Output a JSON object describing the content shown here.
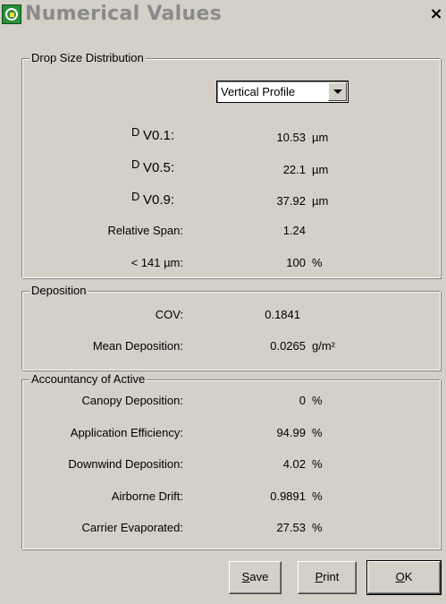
{
  "window": {
    "title": "Numerical Values",
    "close_glyph": "×"
  },
  "drop_size": {
    "legend": "Drop Size Distribution",
    "profile_select": {
      "selected": "Vertical Profile"
    },
    "dv01": {
      "main": "D",
      "sub": "V0.1",
      "suffix": ":",
      "value": "10.53",
      "unit": "µm"
    },
    "dv05": {
      "main": "D",
      "sub": "V0.5",
      "suffix": ":",
      "value": "22.1",
      "unit": "µm"
    },
    "dv09": {
      "main": "D",
      "sub": "V0.9",
      "suffix": ":",
      "value": "37.92",
      "unit": "µm"
    },
    "relative_span": {
      "label": "Relative Span:",
      "value": "1.24"
    },
    "lt141": {
      "label": "< 141 µm:",
      "value": "100",
      "unit": "%"
    }
  },
  "deposition": {
    "legend": "Deposition",
    "cov": {
      "label": "COV:",
      "value": "0.1841"
    },
    "mean": {
      "label": "Mean Deposition:",
      "value": "0.0265",
      "unit": "g/m²"
    }
  },
  "accountancy": {
    "legend": "Accountancy of Active",
    "canopy": {
      "label": "Canopy Deposition:",
      "value": "0",
      "unit": "%"
    },
    "efficiency": {
      "label": "Application Efficiency:",
      "value": "94.99",
      "unit": "%"
    },
    "downwind": {
      "label": "Downwind Deposition:",
      "value": "4.02",
      "unit": "%"
    },
    "airborne": {
      "label": "Airborne Drift:",
      "value": "0.9891",
      "unit": "%"
    },
    "carrier": {
      "label": "Carrier Evaporated:",
      "value": "27.53",
      "unit": "%"
    }
  },
  "buttons": {
    "save": {
      "accel": "S",
      "rest": "ave"
    },
    "print": {
      "accel": "P",
      "rest": "rint"
    },
    "ok": {
      "accel": "O",
      "rest": "K"
    }
  },
  "icons": {
    "app": "app-logo-icon",
    "close": "close-icon",
    "dropdown": "chevron-down-icon"
  }
}
